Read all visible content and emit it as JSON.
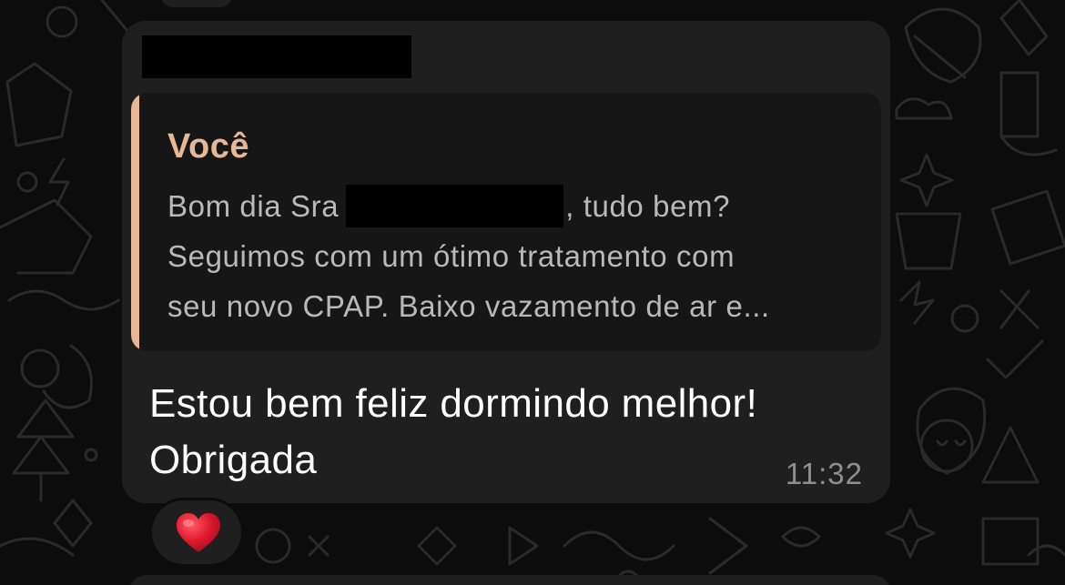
{
  "quoted": {
    "author": "Você",
    "line1_before": "Bom dia Sra",
    "line1_after": ", tudo bem?",
    "line2": "Seguimos com um ótimo tratamento com",
    "line3": "seu novo CPAP. Baixo vazamento de ar e..."
  },
  "message": {
    "line1": "Estou bem feliz dormindo melhor!",
    "line2": "Obrigada",
    "time": "11:32"
  },
  "reaction": {
    "icon": "red-heart-icon"
  },
  "colors": {
    "background": "#0c0c0c",
    "bubble": "#1f1f1f",
    "quote_background": "#161616",
    "quote_accent": "#e7b796",
    "message_text": "#ffffff",
    "time_text": "#8f8f8f",
    "heart": "#e0192e"
  }
}
